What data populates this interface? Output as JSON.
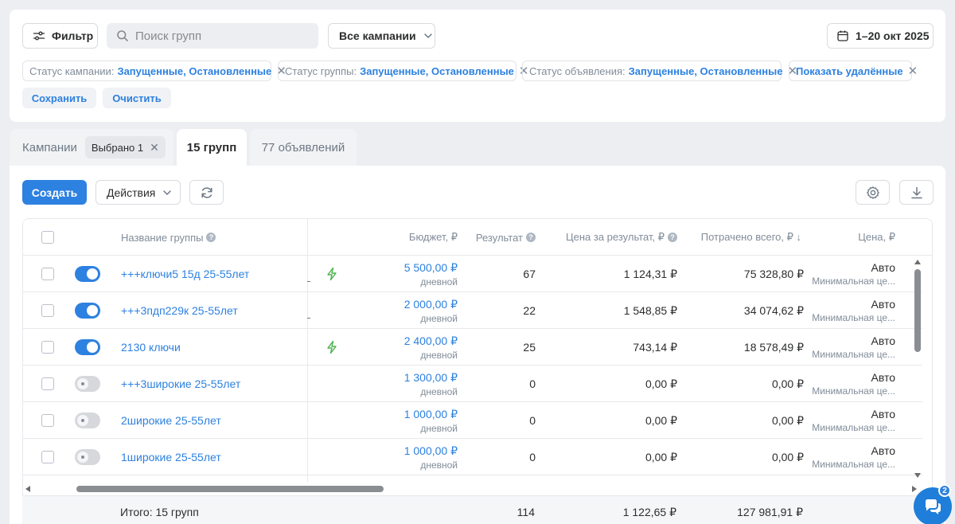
{
  "filters": {
    "filter_label": "Фильтр",
    "search_placeholder": "Поиск групп",
    "campaign_select": "Все кампании",
    "date_range": "1–20 окт 2025",
    "chips": [
      {
        "key": "Статус кампании:",
        "value": "Запущенные, Остановленные"
      },
      {
        "key": "Статус группы:",
        "value": "Запущенные, Остановленные"
      },
      {
        "key": "Статус объявления:",
        "value": "Запущенные, Остановленные"
      },
      {
        "key": "",
        "value": "Показать удалённые"
      }
    ],
    "save_label": "Сохранить",
    "clear_label": "Очистить"
  },
  "tabs": {
    "campaigns": "Кампании",
    "selected_chip": "Выбрано 1",
    "groups": "15 групп",
    "ads": "77 объявлений"
  },
  "toolbar": {
    "create_label": "Создать",
    "actions_label": "Действия"
  },
  "table": {
    "headers": {
      "name": "Название группы",
      "budget": "Бюджет, ₽",
      "result": "Результат",
      "cost_per_result": "Цена за результат, ₽",
      "spent_total": "Потрачено всего, ₽ ↓",
      "price": "Цена, ₽"
    },
    "rows": [
      {
        "enabled": true,
        "name": "+++ключи5 15д 25-55лет",
        "bolt": true,
        "budget": "5 500,00 ₽",
        "budget_period": "дневной",
        "result": "67",
        "cpr": "1 124,31 ₽",
        "spent": "75 328,80 ₽",
        "price": "Авто",
        "price_note": "Минимальная це..."
      },
      {
        "enabled": true,
        "name": "+++3пдп229к 25-55лет",
        "bolt": false,
        "budget": "2 000,00 ₽",
        "budget_period": "дневной",
        "result": "22",
        "cpr": "1 548,85 ₽",
        "spent": "34 074,62 ₽",
        "price": "Авто",
        "price_note": "Минимальная це..."
      },
      {
        "enabled": true,
        "name": "2130 ключи",
        "bolt": true,
        "budget": "2 400,00 ₽",
        "budget_period": "дневной",
        "result": "25",
        "cpr": "743,14 ₽",
        "spent": "18 578,49 ₽",
        "price": "Авто",
        "price_note": "Минимальная це..."
      },
      {
        "enabled": false,
        "name": "+++3широкие 25-55лет",
        "bolt": false,
        "budget": "1 300,00 ₽",
        "budget_period": "дневной",
        "result": "0",
        "cpr": "0,00 ₽",
        "spent": "0,00 ₽",
        "price": "Авто",
        "price_note": "Минимальная це..."
      },
      {
        "enabled": false,
        "name": "2широкие 25-55лет",
        "bolt": false,
        "budget": "1 000,00 ₽",
        "budget_period": "дневной",
        "result": "0",
        "cpr": "0,00 ₽",
        "spent": "0,00 ₽",
        "price": "Авто",
        "price_note": "Минимальная це..."
      },
      {
        "enabled": false,
        "name": "1широкие 25-55лет",
        "bolt": false,
        "budget": "1 000,00 ₽",
        "budget_period": "дневной",
        "result": "0",
        "cpr": "0,00 ₽",
        "spent": "0,00 ₽",
        "price": "Авто",
        "price_note": "Минимальная це..."
      }
    ],
    "totals": {
      "label": "Итого: 15 групп",
      "result": "114",
      "cpr": "1 122,65 ₽",
      "spent": "127 981,91 ₽"
    }
  },
  "chat": {
    "badge": "2"
  },
  "colors": {
    "accent": "#2d81e0",
    "bolt": "#4bb34b"
  }
}
